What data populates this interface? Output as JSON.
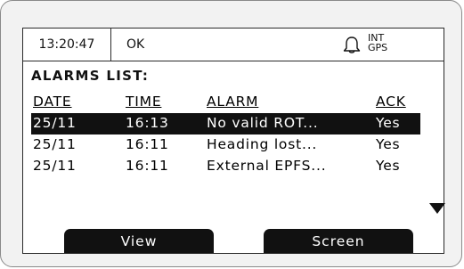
{
  "status": {
    "time": "13:20:47",
    "state": "OK",
    "alert_icon": "bell-icon",
    "sources": [
      "INT",
      "GPS"
    ]
  },
  "list": {
    "title": "ALARMS LIST:",
    "headers": [
      "DATE",
      "TIME",
      "ALARM",
      "ACK"
    ],
    "rows": [
      {
        "date": "25/11",
        "time": "16:13",
        "alarm": "No valid ROT...",
        "ack": "Yes",
        "selected": true
      },
      {
        "date": "25/11",
        "time": "16:11",
        "alarm": "Heading lost...",
        "ack": "Yes",
        "selected": false
      },
      {
        "date": "25/11",
        "time": "16:11",
        "alarm": "External EPFS...",
        "ack": "Yes",
        "selected": false
      }
    ],
    "more_icon": "scroll-down-triangle-icon"
  },
  "softkeys": {
    "left": "View",
    "right": "Screen"
  },
  "colors": {
    "screen_bg": "#ffffff",
    "ink": "#111111",
    "bezel": "#f2f2f2"
  }
}
